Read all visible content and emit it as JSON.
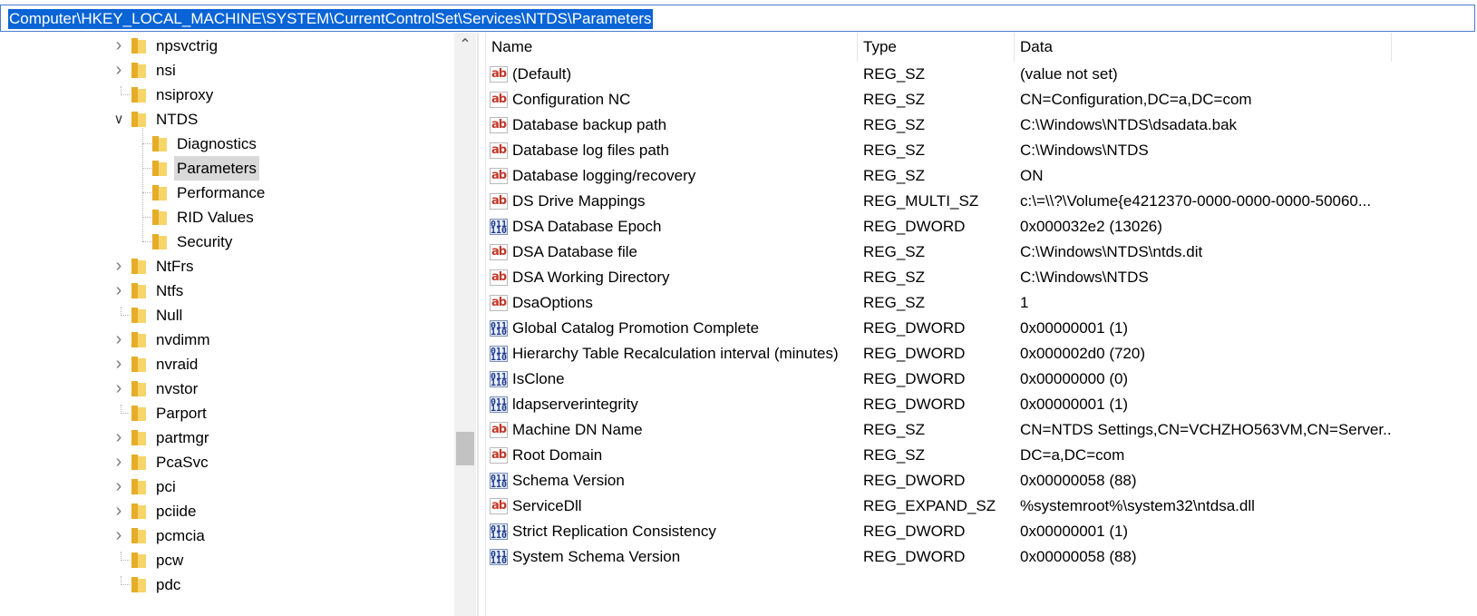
{
  "address": {
    "path": "Computer\\HKEY_LOCAL_MACHINE\\SYSTEM\\CurrentControlSet\\Services\\NTDS\\Parameters"
  },
  "tree": {
    "items": [
      {
        "label": "npsvctrig",
        "expandable": true,
        "level": 0
      },
      {
        "label": "nsi",
        "expandable": true,
        "level": 0
      },
      {
        "label": "nsiproxy",
        "expandable": false,
        "level": 0
      },
      {
        "label": "NTDS",
        "expandable": true,
        "expanded": true,
        "level": 0
      },
      {
        "label": "Diagnostics",
        "level": 1
      },
      {
        "label": "Parameters",
        "level": 1,
        "selected": true
      },
      {
        "label": "Performance",
        "level": 1
      },
      {
        "label": "RID Values",
        "level": 1
      },
      {
        "label": "Security",
        "level": 1
      },
      {
        "label": "NtFrs",
        "expandable": true,
        "level": 0
      },
      {
        "label": "Ntfs",
        "expandable": true,
        "level": 0
      },
      {
        "label": "Null",
        "expandable": false,
        "level": 0
      },
      {
        "label": "nvdimm",
        "expandable": true,
        "level": 0
      },
      {
        "label": "nvraid",
        "expandable": true,
        "level": 0
      },
      {
        "label": "nvstor",
        "expandable": true,
        "level": 0
      },
      {
        "label": "Parport",
        "expandable": false,
        "level": 0
      },
      {
        "label": "partmgr",
        "expandable": true,
        "level": 0
      },
      {
        "label": "PcaSvc",
        "expandable": true,
        "level": 0
      },
      {
        "label": "pci",
        "expandable": true,
        "level": 0
      },
      {
        "label": "pciide",
        "expandable": true,
        "level": 0
      },
      {
        "label": "pcmcia",
        "expandable": true,
        "level": 0
      },
      {
        "label": "pcw",
        "expandable": false,
        "level": 0
      },
      {
        "label": "pdc",
        "expandable": false,
        "level": 0
      }
    ]
  },
  "list": {
    "headers": {
      "name": "Name",
      "type": "Type",
      "data": "Data"
    },
    "rows": [
      {
        "icon": "ab",
        "name": "(Default)",
        "type": "REG_SZ",
        "data": "(value not set)"
      },
      {
        "icon": "ab",
        "name": "Configuration NC",
        "type": "REG_SZ",
        "data": "CN=Configuration,DC=a,DC=com"
      },
      {
        "icon": "ab",
        "name": "Database backup path",
        "type": "REG_SZ",
        "data": "C:\\Windows\\NTDS\\dsadata.bak"
      },
      {
        "icon": "ab",
        "name": "Database log files path",
        "type": "REG_SZ",
        "data": "C:\\Windows\\NTDS"
      },
      {
        "icon": "ab",
        "name": "Database logging/recovery",
        "type": "REG_SZ",
        "data": "ON"
      },
      {
        "icon": "ab",
        "name": "DS Drive Mappings",
        "type": "REG_MULTI_SZ",
        "data": "c:\\=\\\\?\\Volume{e4212370-0000-0000-0000-50060..."
      },
      {
        "icon": "bin",
        "name": "DSA Database Epoch",
        "type": "REG_DWORD",
        "data": "0x000032e2 (13026)"
      },
      {
        "icon": "ab",
        "name": "DSA Database file",
        "type": "REG_SZ",
        "data": "C:\\Windows\\NTDS\\ntds.dit"
      },
      {
        "icon": "ab",
        "name": "DSA Working Directory",
        "type": "REG_SZ",
        "data": "C:\\Windows\\NTDS"
      },
      {
        "icon": "ab",
        "name": "DsaOptions",
        "type": "REG_SZ",
        "data": "1"
      },
      {
        "icon": "bin",
        "name": "Global Catalog Promotion Complete",
        "type": "REG_DWORD",
        "data": "0x00000001 (1)"
      },
      {
        "icon": "bin",
        "name": "Hierarchy Table Recalculation interval (minutes)",
        "type": "REG_DWORD",
        "data": "0x000002d0 (720)"
      },
      {
        "icon": "bin",
        "name": "IsClone",
        "type": "REG_DWORD",
        "data": "0x00000000 (0)"
      },
      {
        "icon": "bin",
        "name": "ldapserverintegrity",
        "type": "REG_DWORD",
        "data": "0x00000001 (1)"
      },
      {
        "icon": "ab",
        "name": "Machine DN Name",
        "type": "REG_SZ",
        "data": "CN=NTDS Settings,CN=VCHZHO563VM,CN=Server..."
      },
      {
        "icon": "ab",
        "name": "Root Domain",
        "type": "REG_SZ",
        "data": "DC=a,DC=com"
      },
      {
        "icon": "bin",
        "name": "Schema Version",
        "type": "REG_DWORD",
        "data": "0x00000058 (88)"
      },
      {
        "icon": "ab",
        "name": "ServiceDll",
        "type": "REG_EXPAND_SZ",
        "data": "%systemroot%\\system32\\ntdsa.dll"
      },
      {
        "icon": "bin",
        "name": "Strict Replication Consistency",
        "type": "REG_DWORD",
        "data": "0x00000001 (1)"
      },
      {
        "icon": "bin",
        "name": "System Schema Version",
        "type": "REG_DWORD",
        "data": "0x00000058 (88)"
      }
    ]
  },
  "icons": {
    "expand": "chevron-right-icon",
    "collapse": "chevron-down-icon",
    "folder": "folder-icon",
    "string_value": "reg-string-icon",
    "binary_value": "reg-binary-icon",
    "scroll_up": "chevron-up-icon"
  }
}
